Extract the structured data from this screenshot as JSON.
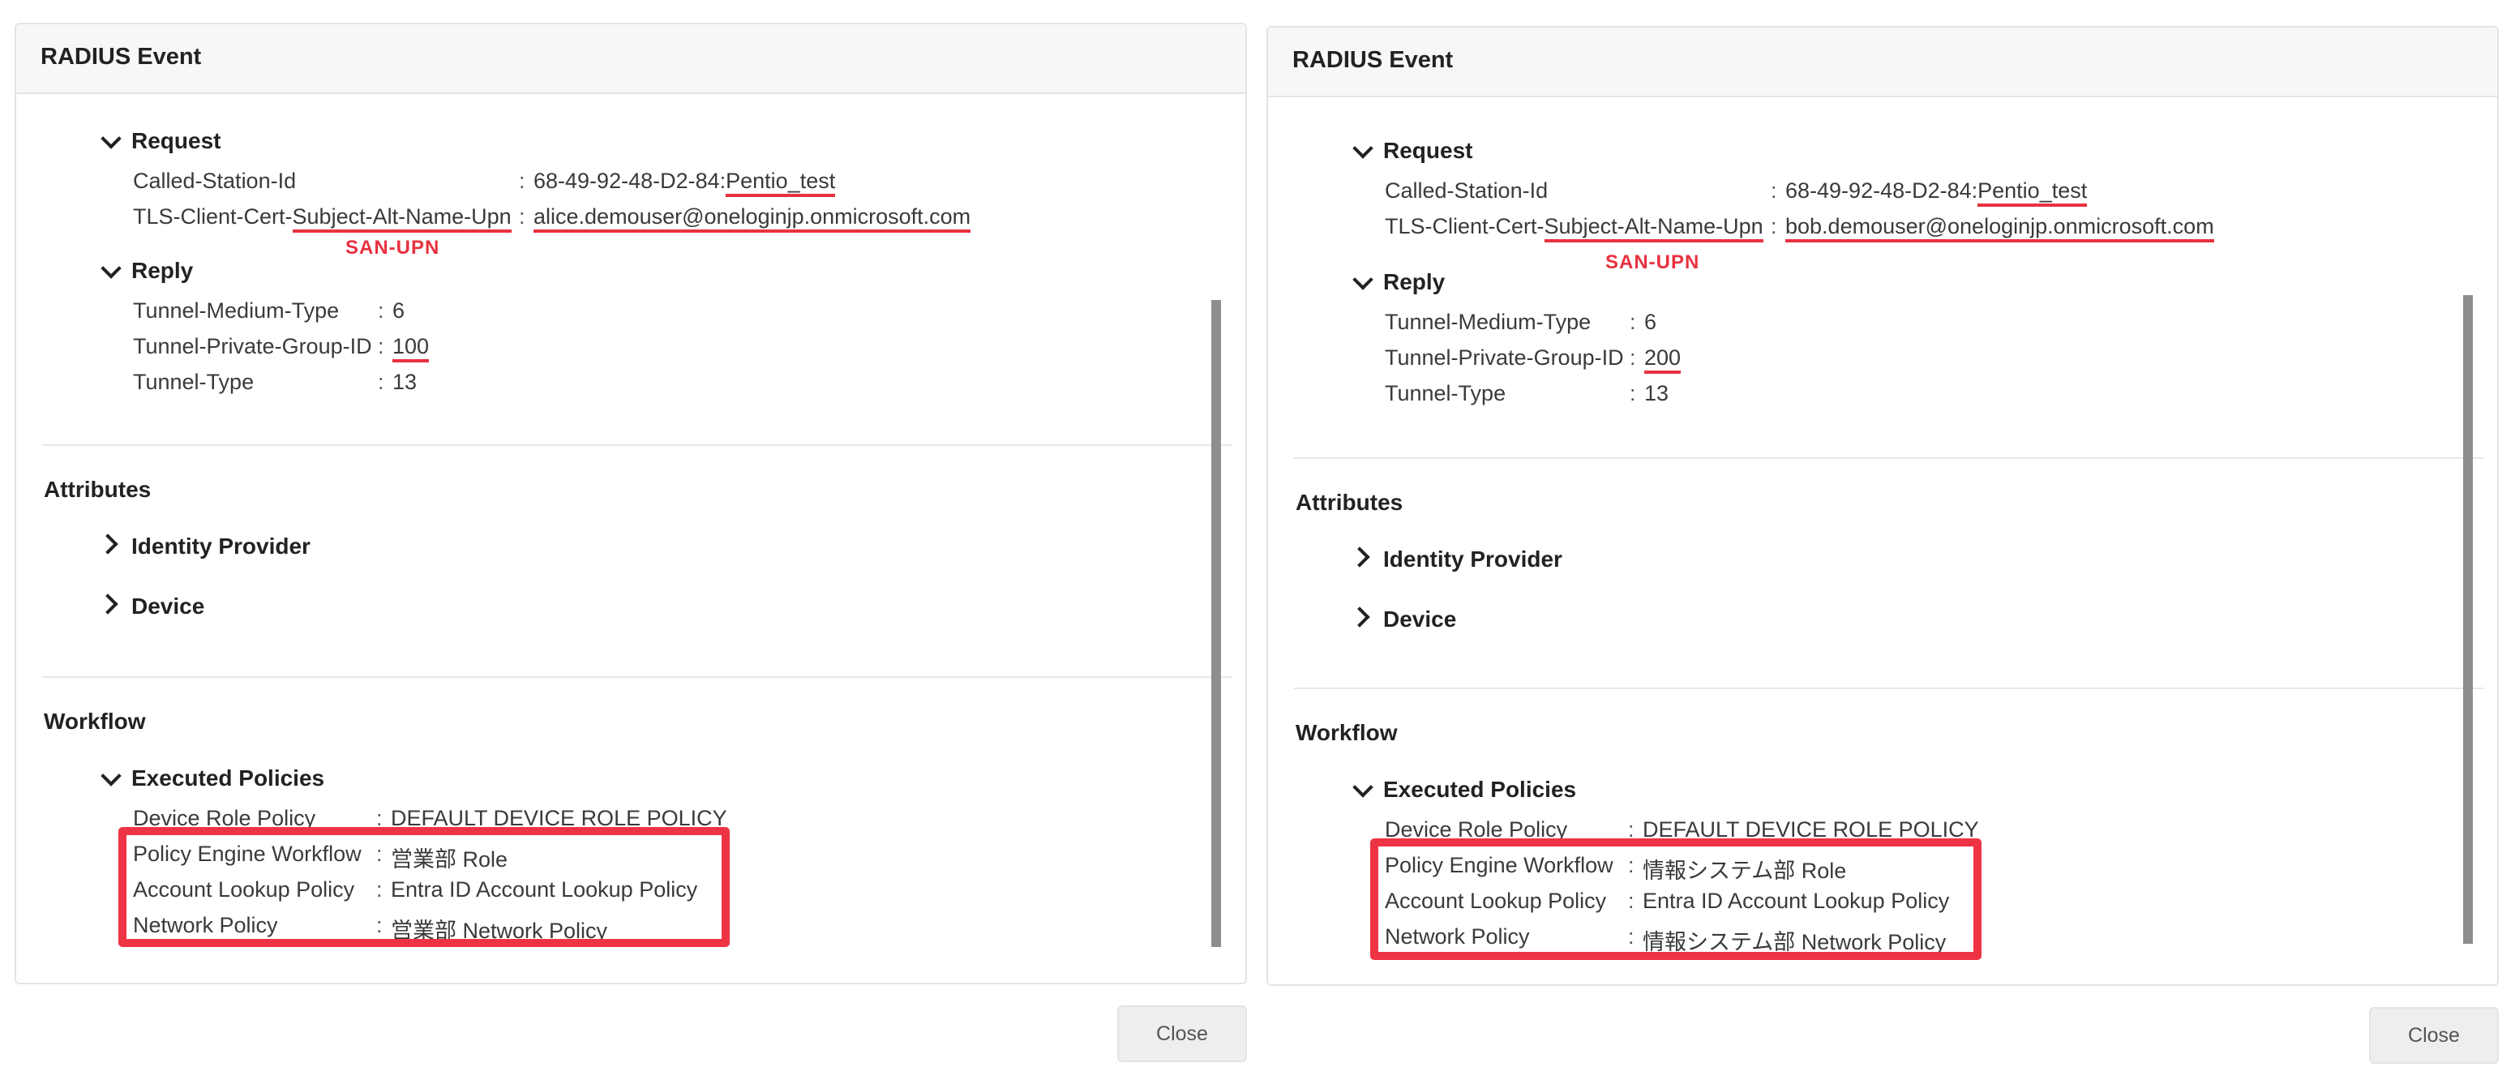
{
  "panels": [
    {
      "title": "RADIUS Event",
      "request": {
        "label": "Request",
        "called_station_key": "Called-Station-Id",
        "called_station_value_prefix": "68-49-92-48-D2-84:",
        "called_station_value_ssid": "Pentio_test",
        "tls_key_prefix": "TLS-Client-Cert-",
        "tls_key_highlight": "Subject-Alt-Name-Upn",
        "tls_value": "alice.demouser@oneloginjp.onmicrosoft.com",
        "annotation": "SAN-UPN"
      },
      "reply": {
        "label": "Reply",
        "rows": [
          {
            "key": "Tunnel-Medium-Type",
            "value": "6"
          },
          {
            "key": "Tunnel-Private-Group-ID",
            "value": "100"
          },
          {
            "key": "Tunnel-Type",
            "value": "13"
          }
        ]
      },
      "attributes": {
        "title": "Attributes",
        "items": [
          "Identity Provider",
          "Device"
        ]
      },
      "workflow": {
        "title": "Workflow",
        "executed_label": "Executed Policies",
        "policies": [
          {
            "key": "Device Role Policy",
            "value": "DEFAULT DEVICE ROLE POLICY"
          },
          {
            "key": "Policy Engine Workflow",
            "value": "営業部 Role"
          },
          {
            "key": "Account Lookup Policy",
            "value": "Entra ID Account Lookup Policy"
          },
          {
            "key": "Network Policy",
            "value": "営業部 Network Policy"
          }
        ]
      },
      "close_label": "Close"
    },
    {
      "title": "RADIUS Event",
      "request": {
        "label": "Request",
        "called_station_key": "Called-Station-Id",
        "called_station_value_prefix": "68-49-92-48-D2-84:",
        "called_station_value_ssid": "Pentio_test",
        "tls_key_prefix": "TLS-Client-Cert-",
        "tls_key_highlight": "Subject-Alt-Name-Upn",
        "tls_value": "bob.demouser@oneloginjp.onmicrosoft.com",
        "annotation": "SAN-UPN"
      },
      "reply": {
        "label": "Reply",
        "rows": [
          {
            "key": "Tunnel-Medium-Type",
            "value": "6"
          },
          {
            "key": "Tunnel-Private-Group-ID",
            "value": "200"
          },
          {
            "key": "Tunnel-Type",
            "value": "13"
          }
        ]
      },
      "attributes": {
        "title": "Attributes",
        "items": [
          "Identity Provider",
          "Device"
        ]
      },
      "workflow": {
        "title": "Workflow",
        "executed_label": "Executed Policies",
        "policies": [
          {
            "key": "Device Role Policy",
            "value": "DEFAULT DEVICE ROLE POLICY"
          },
          {
            "key": "Policy Engine Workflow",
            "value": "情報システム部 Role"
          },
          {
            "key": "Account Lookup Policy",
            "value": "Entra ID Account Lookup Policy"
          },
          {
            "key": "Network Policy",
            "value": "情報システム部 Network Policy"
          }
        ]
      },
      "close_label": "Close"
    }
  ],
  "colors": {
    "annotation_red": "#e8313f",
    "header_bg": "#f7f7f7",
    "border": "#e4e4e4"
  }
}
